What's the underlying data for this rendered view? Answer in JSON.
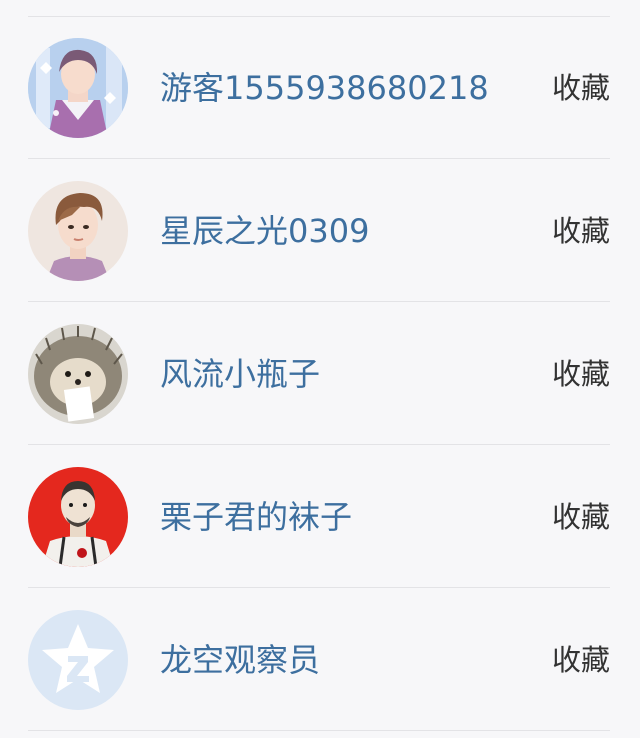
{
  "users": [
    {
      "name": "游客1555938680218",
      "action": "收藏",
      "avatar": "anime-boy-avatar"
    },
    {
      "name": "星辰之光0309",
      "action": "收藏",
      "avatar": "portrait-avatar"
    },
    {
      "name": "风流小瓶子",
      "action": "收藏",
      "avatar": "hedgehog-avatar"
    },
    {
      "name": "栗子君的袜子",
      "action": "收藏",
      "avatar": "illustrated-man-avatar"
    },
    {
      "name": "龙空观察员",
      "action": "收藏",
      "avatar": "default-qq-avatar"
    }
  ],
  "colors": {
    "name": "#3d6f9f",
    "action": "#333333",
    "divider": "#e3e3e6",
    "background": "#f7f7f9"
  }
}
